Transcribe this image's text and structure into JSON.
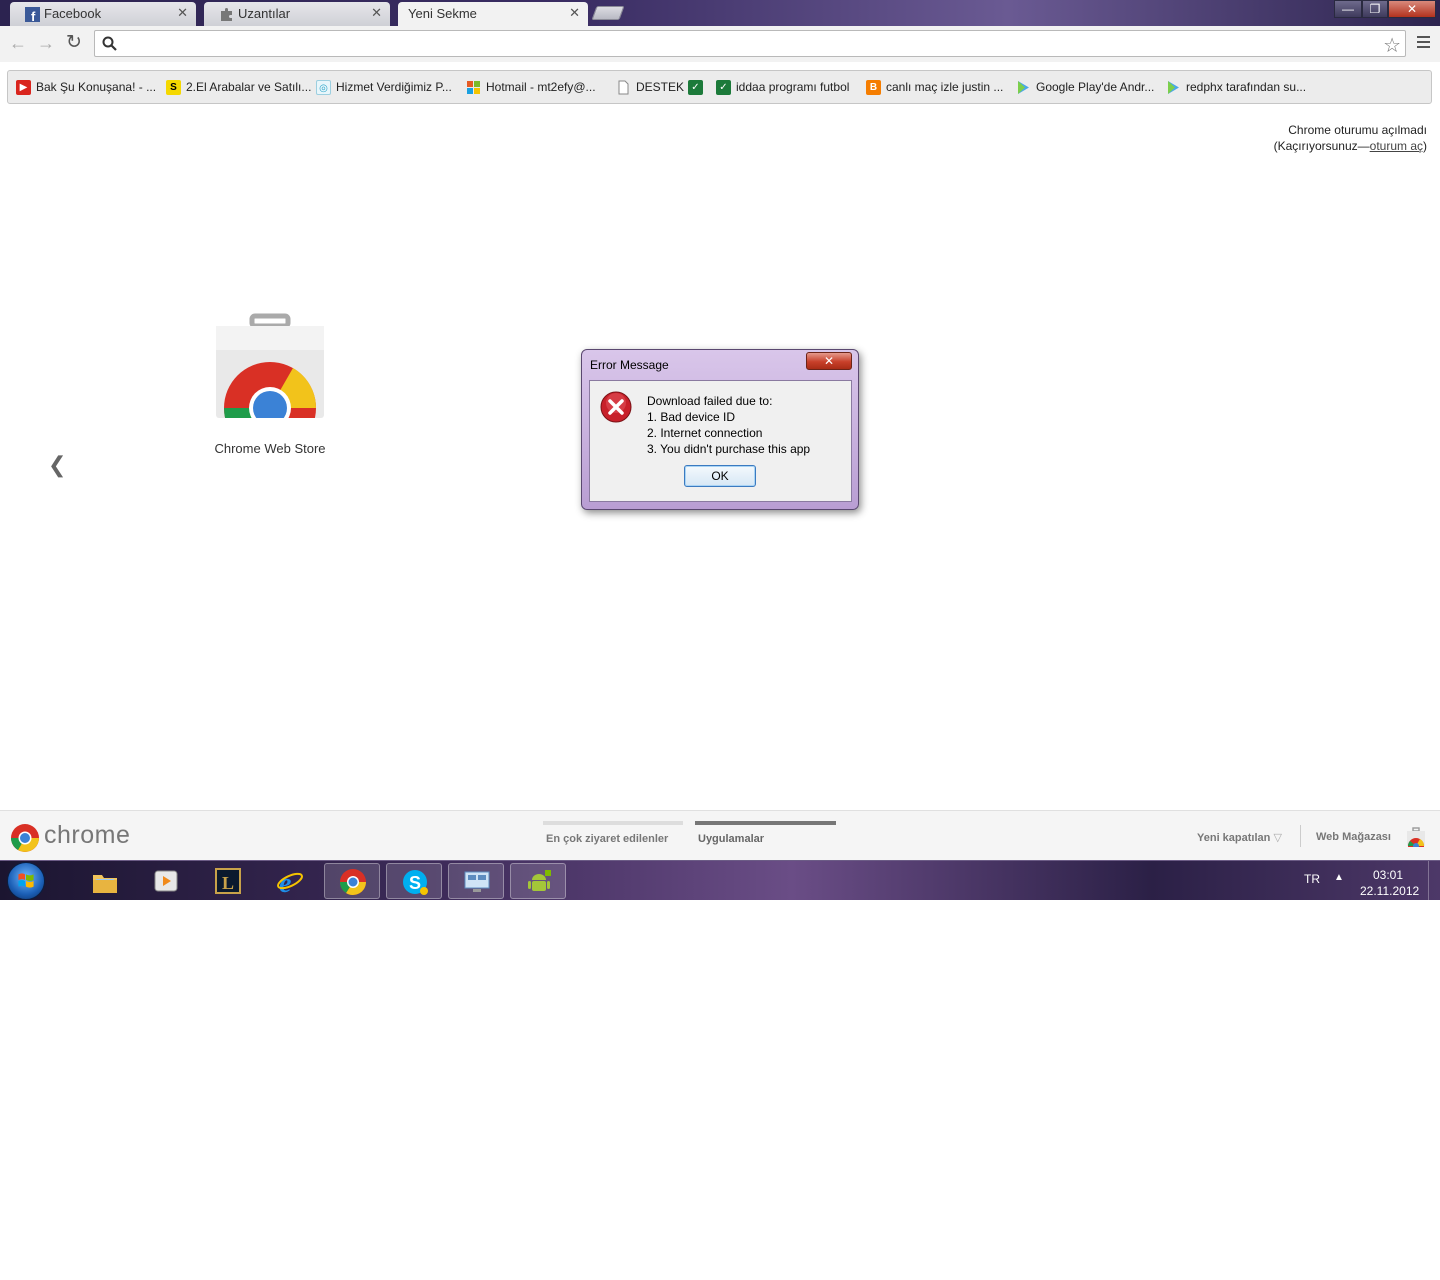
{
  "browser": {
    "tabs": [
      {
        "title": "Facebook",
        "icon": "facebook-icon"
      },
      {
        "title": "Uzantılar",
        "icon": "puzzle-icon"
      },
      {
        "title": "Yeni Sekme",
        "active": true
      }
    ],
    "omnibox": {
      "value": "",
      "placeholder": ""
    },
    "window_controls": {
      "minimize": "—",
      "restore": "❐",
      "close": "✕"
    }
  },
  "bookmarks": [
    {
      "label": "Bak Şu Konuşana! - ...",
      "icon": "youtube-icon",
      "color": "#d9251d"
    },
    {
      "label": "2.El Arabalar ve Satılı...",
      "icon": "sahibinden-icon",
      "color": "#f5d800"
    },
    {
      "label": "Hizmet Verdiğimiz P...",
      "icon": "globe-icon",
      "color": "#2aa4c8"
    },
    {
      "label": "Hotmail - mt2efy@...",
      "icon": "windows-flag-icon",
      "color": "#e55b25"
    },
    {
      "label": "DESTEK",
      "icon": "page-icon",
      "color": "#ffffff"
    },
    {
      "label": "",
      "icon": "iddaa-icon",
      "color": "#1c7a3a"
    },
    {
      "label": "iddaa programı futbol",
      "icon": "iddaa-icon",
      "color": "#1c7a3a"
    },
    {
      "label": "canlı maç izle justin ...",
      "icon": "blogger-icon",
      "color": "#f57d00"
    },
    {
      "label": "Google Play'de Andr...",
      "icon": "play-store-icon",
      "color": "#4aa8e8"
    },
    {
      "label": "redphx tarafından su...",
      "icon": "play-store-icon",
      "color": "#4aa8e8"
    }
  ],
  "signin": {
    "line1": "Chrome oturumu açılmadı",
    "line2_prefix": "(Kaçırıyorsunuz—",
    "line2_link": "oturum aç",
    "line2_suffix": ")"
  },
  "apps": [
    {
      "label": "Chrome Web Store",
      "icon": "chrome-web-store-icon"
    }
  ],
  "dialog": {
    "title": "Error Message",
    "close": "✕",
    "message_lines": [
      "Download failed due to:",
      "1. Bad device ID",
      "2. Internet connection",
      "3. You didn't purchase this app"
    ],
    "ok_label": "OK"
  },
  "footer": {
    "wordmark": "chrome",
    "tab_most_visited": "En çok ziyaret edilenler",
    "tab_apps": "Uygulamalar",
    "recently_closed": "Yeni kapatılan",
    "web_store": "Web Mağazası"
  },
  "taskbar": {
    "apps": [
      {
        "icon": "file-explorer-icon",
        "running": false
      },
      {
        "icon": "media-player-icon",
        "running": false
      },
      {
        "icon": "league-of-legends-icon",
        "running": false
      },
      {
        "icon": "internet-explorer-icon",
        "running": false
      },
      {
        "icon": "chrome-icon",
        "running": true
      },
      {
        "icon": "skype-icon",
        "running": true
      },
      {
        "icon": "remote-desktop-icon",
        "running": true
      },
      {
        "icon": "android-icon",
        "running": true
      }
    ],
    "language": "TR",
    "time": "03:01",
    "date": "22.11.2012"
  }
}
